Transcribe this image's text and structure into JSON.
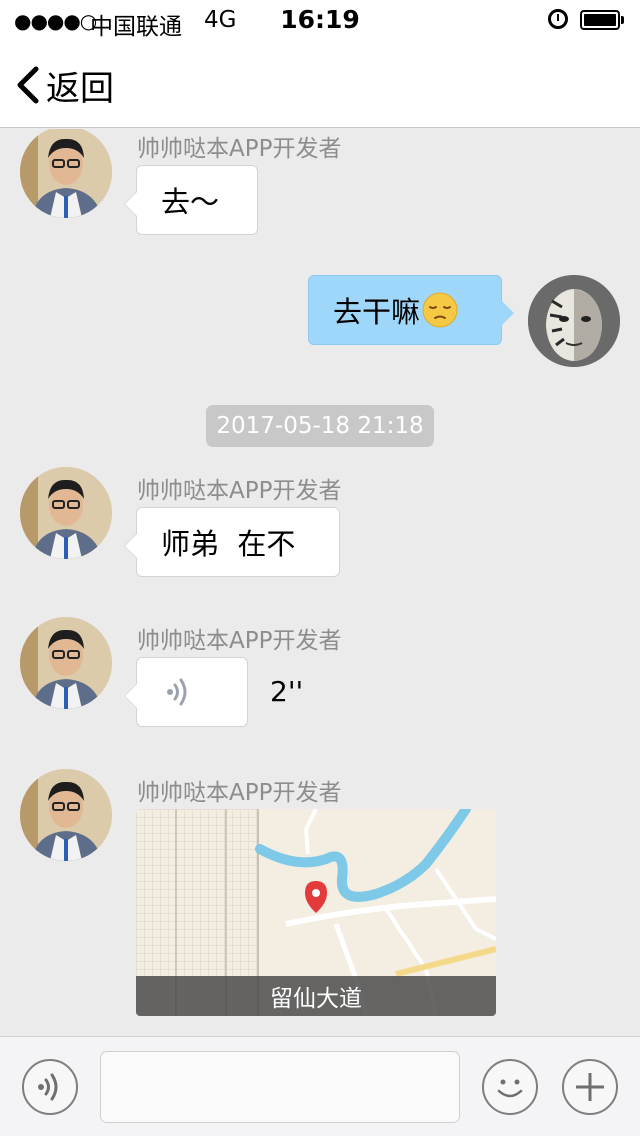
{
  "status_bar": {
    "signal": "●●●●○",
    "carrier": "中国联通",
    "network": "4G",
    "time": "16:19",
    "icons": [
      "alarm-icon",
      "battery-icon"
    ],
    "battery_level": 1.0
  },
  "nav": {
    "back_label": "返回",
    "back_icon": "chevron-left-icon"
  },
  "messages": [
    {
      "type": "text",
      "direction": "incoming",
      "sender": "帅帅哒本APP开发者",
      "text": "去～"
    },
    {
      "type": "text",
      "direction": "outgoing",
      "text": "去干嘛",
      "emoji": "pensive-face-icon"
    },
    {
      "type": "timestamp",
      "text": "2017-05-18 21:18"
    },
    {
      "type": "text",
      "direction": "incoming",
      "sender": "帅帅哒本APP开发者",
      "text": "师弟  在不"
    },
    {
      "type": "voice",
      "direction": "incoming",
      "sender": "帅帅哒本APP开发者",
      "duration": "2''",
      "icon": "voice-wave-icon"
    },
    {
      "type": "location",
      "direction": "incoming",
      "sender": "帅帅哒本APP开发者",
      "location_name": "留仙大道",
      "icon": "map-pin-icon"
    }
  ],
  "input_bar": {
    "voice_icon": "voice-input-icon",
    "text_value": "",
    "emoji_icon": "smiley-icon",
    "plus_icon": "plus-icon"
  },
  "colors": {
    "background": "#ebebeb",
    "outgoing_bubble": "#9fd7fa",
    "incoming_bubble": "#ffffff",
    "sender_text": "#8d8d8d",
    "timestamp_bg": "#c8c8c8"
  }
}
